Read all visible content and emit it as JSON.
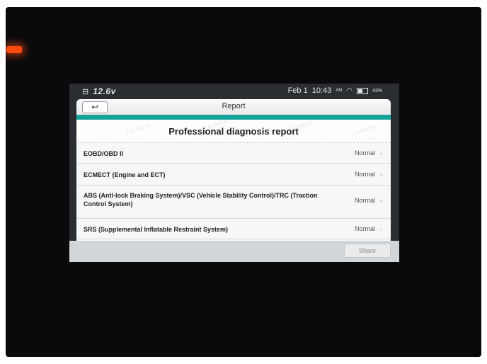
{
  "status_bar": {
    "voltage": "12.6v",
    "date": "Feb 1",
    "time": "10:43",
    "ampm": "AM",
    "battery_percent": "43%",
    "battery_level": 0.43
  },
  "app_bar": {
    "back_icon": "back-arrow-icon",
    "title": "Report"
  },
  "report": {
    "title": "Professional diagnosis report",
    "watermark": "LAUNCH",
    "rows": [
      {
        "name": "EOBD/OBD II",
        "status": "Normal"
      },
      {
        "name": "ECMECT (Engine and ECT)",
        "status": "Normal"
      },
      {
        "name": "ABS (Anti-lock Braking System)/VSC (Vehicle Stability Control)/TRC (Traction Control System)",
        "status": "Normal"
      },
      {
        "name": "SRS (Supplemental Inflatable Restraint System)",
        "status": "Normal"
      }
    ]
  },
  "footer": {
    "share_label": "Share"
  },
  "colors": {
    "accent": "#14a39a",
    "led": "#ff4a12"
  }
}
